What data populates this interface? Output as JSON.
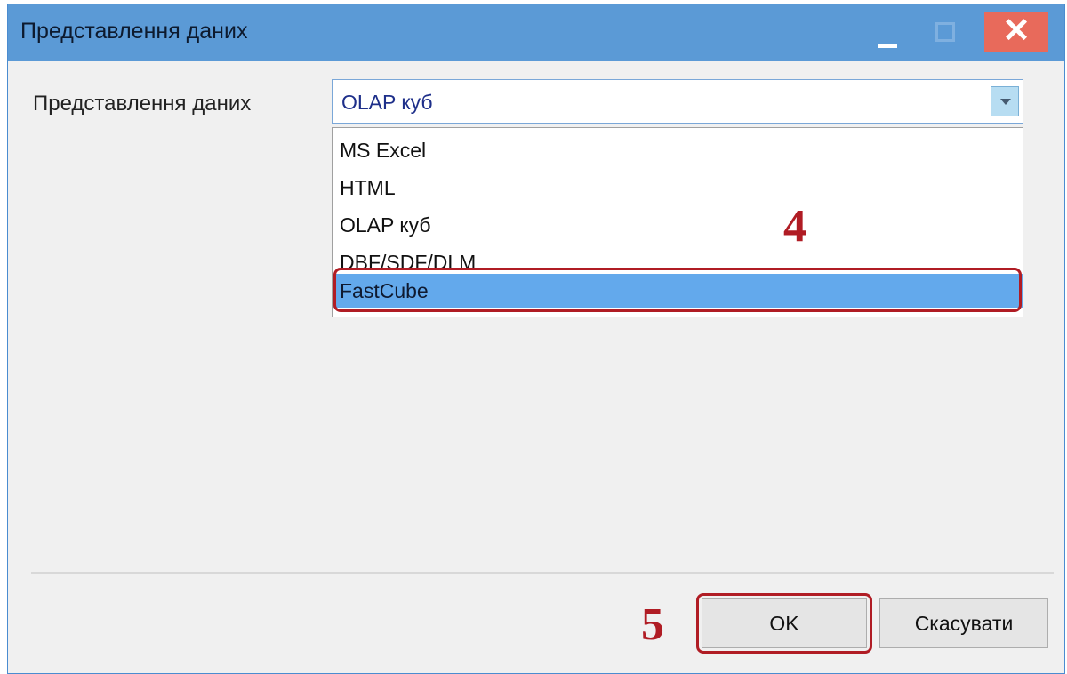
{
  "window": {
    "title": "Представлення даних",
    "close_symbol": "✕",
    "title_color": "#5b9ad6",
    "close_color": "#e86a5b"
  },
  "form": {
    "label": "Представлення даних",
    "selected_value": "OLAP куб"
  },
  "dropdown": {
    "options": [
      "MS Excel",
      "HTML",
      "OLAP куб",
      "DBF/SDF/DLM",
      "FastCube"
    ],
    "highlighted": "FastCube"
  },
  "annotations": {
    "step4": "4",
    "step5": "5",
    "color": "#b01c24"
  },
  "buttons": {
    "ok": "OK",
    "cancel": "Скасувати"
  },
  "icons": {
    "minimize": "minimize-icon",
    "maximize": "maximize-icon",
    "close": "close-icon",
    "dropdown": "chevron-down-icon"
  }
}
